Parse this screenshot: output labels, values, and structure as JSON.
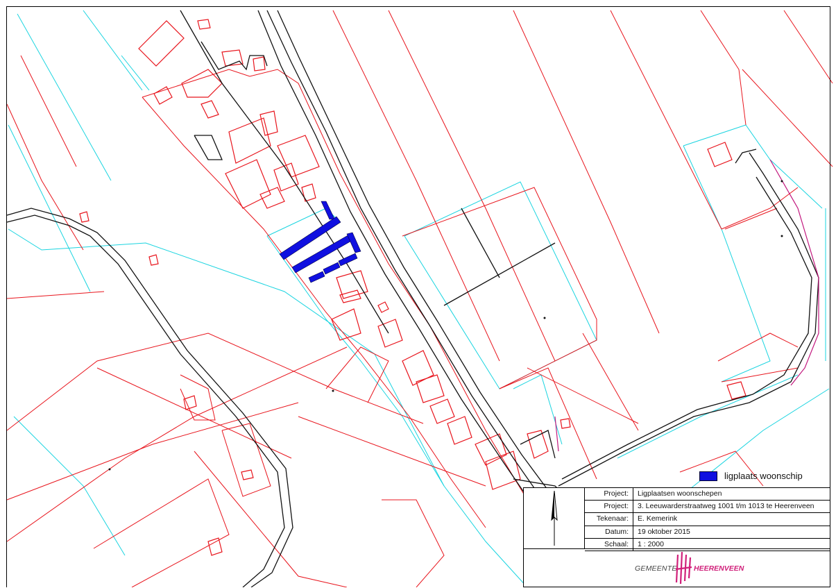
{
  "legend": {
    "label": "ligplaats woonschip",
    "color": "#1010e0"
  },
  "titleblock": {
    "rows": [
      {
        "key": "Project:",
        "value": "Ligplaatsen woonschepen"
      },
      {
        "key": "Project:",
        "value": "3. Leeuwarderstraatweg 1001 t/m 1013 te Heerenveen"
      },
      {
        "key": "Tekenaar:",
        "value": "E. Kemerink"
      },
      {
        "key": "Datum:",
        "value": "19 oktober 2015"
      },
      {
        "key": "Schaal:",
        "value": "1 : 2000"
      }
    ],
    "logo_left": "GEMEENTE",
    "logo_right": "HEERENVEEN",
    "north_icon": "north-arrow-icon"
  },
  "colors": {
    "parcel": "#e8141c",
    "water": "#19d4e0",
    "road": "#111111",
    "mooring": "#1010e0",
    "boundary": "#c2187e"
  }
}
